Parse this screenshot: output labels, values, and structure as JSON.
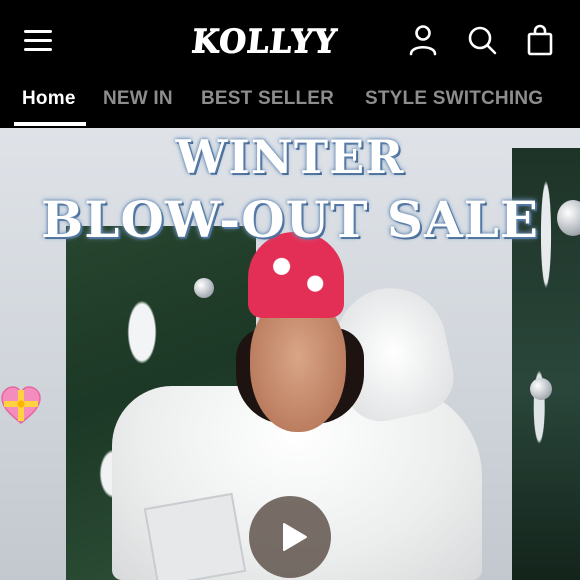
{
  "header": {
    "logo_text": "KOLLYY",
    "menu_icon": "hamburger-menu-icon",
    "account_icon": "user-icon",
    "search_icon": "search-icon",
    "cart_icon": "shopping-bag-icon"
  },
  "nav": {
    "tabs": [
      {
        "label": "Home",
        "active": true
      },
      {
        "label": "NEW IN",
        "active": false
      },
      {
        "label": "BEST SELLER",
        "active": false
      },
      {
        "label": "STYLE SWITCHING",
        "active": false
      }
    ]
  },
  "hero": {
    "headline_line1": "WINTER",
    "headline_line2": "BLOW-OUT SALE",
    "gift_icon": "gift-heart-icon",
    "play_icon": "play-icon"
  },
  "colors": {
    "background": "#000000",
    "active_tab": "#ffffff",
    "inactive_tab": "#8d8d8d",
    "beanie": "#e32f55"
  }
}
